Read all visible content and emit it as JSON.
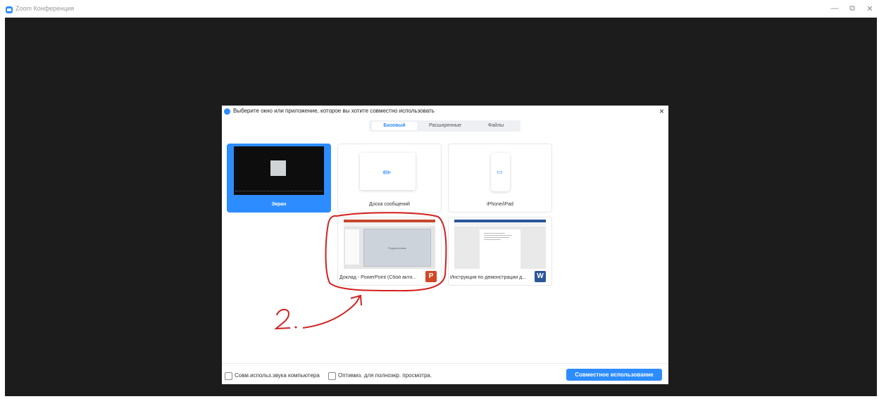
{
  "window": {
    "title": "Zoom Конференция",
    "controls": {
      "minimize": "—",
      "restore": "⧉",
      "close": "✕"
    }
  },
  "dialog": {
    "title": "Выберите окно или приложение, которое вы хотите совместно использовать",
    "close": "×",
    "tabs": [
      {
        "label": "Базовый",
        "active": true
      },
      {
        "label": "Расширенные",
        "active": false
      },
      {
        "label": "Файлы",
        "active": false
      }
    ],
    "tiles": [
      {
        "label": "Экран",
        "selected": true,
        "icon": "screen-thumbnail"
      },
      {
        "label": "Доска сообщений",
        "selected": false,
        "icon": "pen-icon"
      },
      {
        "label": "iPhone/iPad",
        "selected": false,
        "icon": "airplay-icon"
      },
      {
        "label": "Доклад - PowerPoint (Сбой акти...",
        "selected": false,
        "icon": "powerpoint-icon",
        "badge": "P",
        "slide_text": "Подзаголовок"
      },
      {
        "label": "Инструкция по демонстрации д...",
        "selected": false,
        "icon": "word-icon",
        "badge": "W"
      }
    ],
    "footer": {
      "checkbox_audio": "Совм.использ.звука компьютера",
      "checkbox_optimize": "Оптимиз. для полноэкр. просмотра.",
      "share_button": "Совместное использование"
    }
  },
  "annotation": {
    "text": "2.",
    "color": "#d42020"
  },
  "colors": {
    "accent": "#2D8CFF",
    "stage": "#1c1c1c"
  }
}
